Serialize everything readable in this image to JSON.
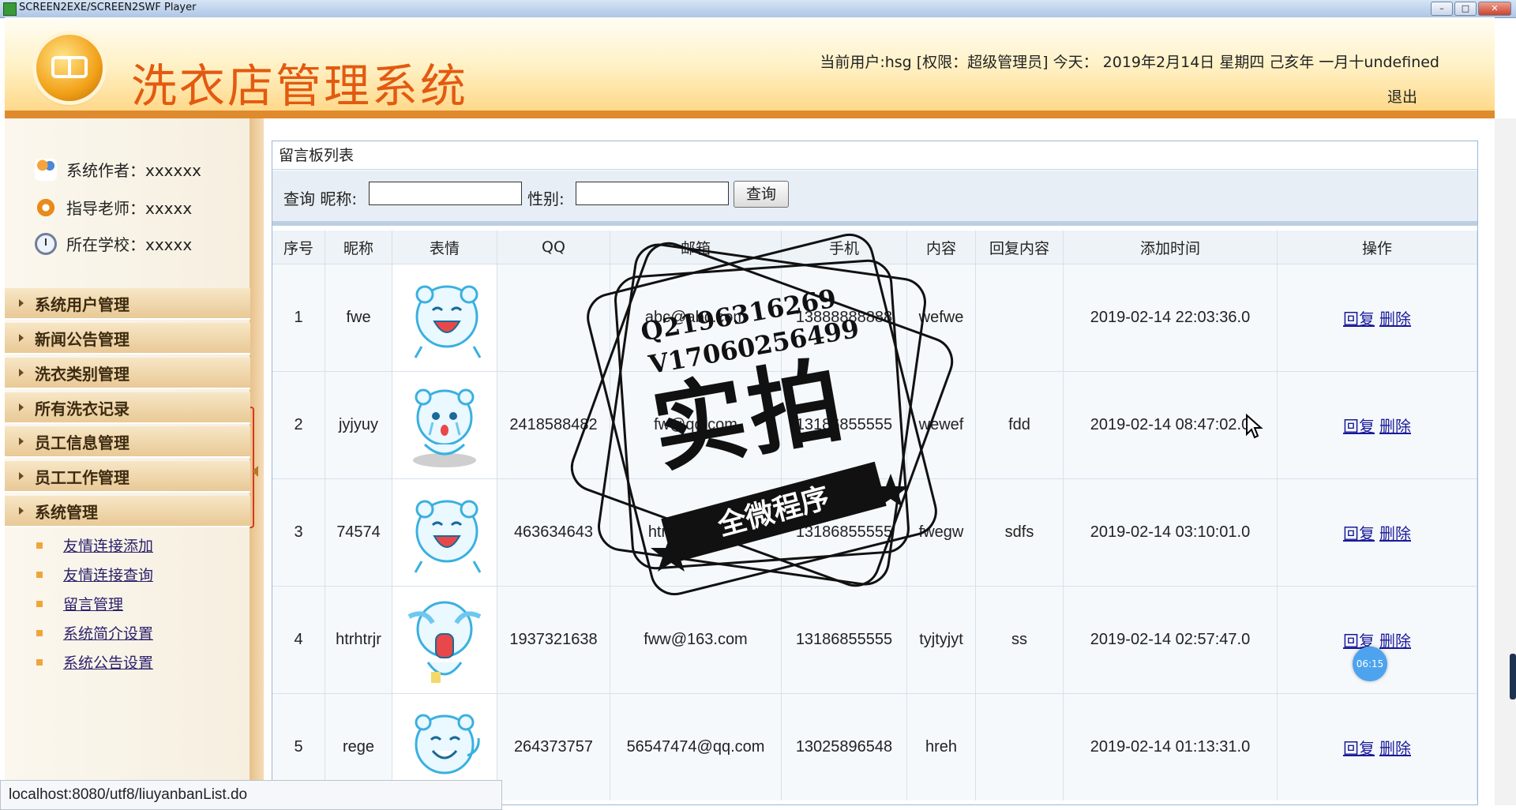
{
  "window": {
    "title": "SCREEN2EXE/SCREEN2SWF Player"
  },
  "header": {
    "title": "洗衣店管理系统",
    "user_info": "当前用户:hsg [权限：超级管理员] 今天： 2019年2月14日 星期四 己亥年 一月十undefined",
    "logout": "退出"
  },
  "sidebar": {
    "info": [
      {
        "label": "系统作者：xxxxxx",
        "icon": "users-icon"
      },
      {
        "label": "指导老师：xxxxx",
        "icon": "phone-icon"
      },
      {
        "label": "所在学校：xxxxx",
        "icon": "clock-icon"
      }
    ],
    "menu": [
      "系统用户管理",
      "新闻公告管理",
      "洗衣类别管理",
      "所有洗衣记录",
      "员工信息管理",
      "员工工作管理",
      "系统管理"
    ],
    "submenu": [
      "友情连接添加",
      "友情连接查询",
      "留言管理",
      "系统简介设置",
      "系统公告设置"
    ]
  },
  "panel": {
    "title": "留言板列表",
    "search": {
      "nickname_label": "查询 昵称:",
      "nickname_value": "",
      "gender_label": "性别:",
      "gender_value": "",
      "button": "查询"
    }
  },
  "table": {
    "headers": [
      "序号",
      "昵称",
      "表情",
      "QQ",
      "邮箱",
      "手机",
      "内容",
      "回复内容",
      "添加时间",
      "操作"
    ],
    "rows": [
      {
        "no": "1",
        "nick": "fwe",
        "qq": "",
        "email": "abc@abc.com",
        "phone": "13888888888",
        "content": "wefwe",
        "reply": "",
        "time": "2019-02-14 22:03:36.0"
      },
      {
        "no": "2",
        "nick": "jyjyuy",
        "qq": "2418588482",
        "email": "fw@qq.com",
        "phone": "13186855555",
        "content": "wewef",
        "reply": "fdd",
        "time": "2019-02-14 08:47:02.0"
      },
      {
        "no": "3",
        "nick": "74574",
        "qq": "463634643",
        "email": "htr@163.com",
        "phone": "13186855555",
        "content": "fwegw",
        "reply": "sdfs",
        "time": "2019-02-14 03:10:01.0"
      },
      {
        "no": "4",
        "nick": "htrhtrjr",
        "qq": "1937321638",
        "email": "fww@163.com",
        "phone": "13186855555",
        "content": "tyjtyjyt",
        "reply": "ss",
        "time": "2019-02-14 02:57:47.0"
      },
      {
        "no": "5",
        "nick": "rege",
        "qq": "264373757",
        "email": "56547474@qq.com",
        "phone": "13025896548",
        "content": "hreh",
        "reply": "",
        "time": "2019-02-14 01:13:31.0"
      }
    ],
    "reply_label": "回复",
    "delete_label": "删除"
  },
  "watermark": {
    "q": "Q2196316269",
    "v": "V17060256499",
    "main": "实拍",
    "ribbon": "全微程序"
  },
  "overlay": {
    "timer": "06:15"
  },
  "statusbar": {
    "url": "localhost:8080/utf8/liuyanbanList.do"
  },
  "colors": {
    "accent": "#e25a10",
    "header_band": "#e08a2e",
    "link": "#1a1a9a"
  }
}
